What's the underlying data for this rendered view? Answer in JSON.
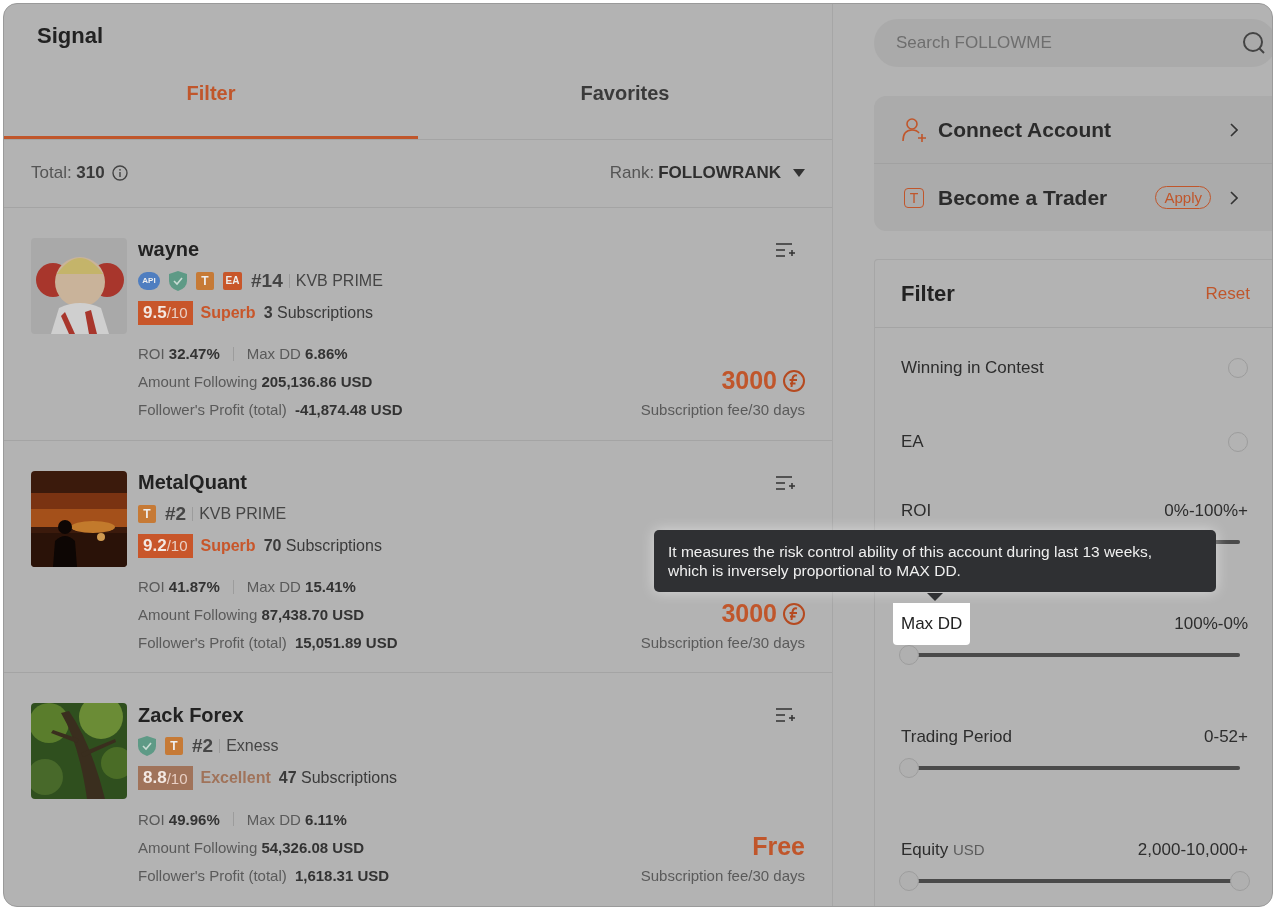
{
  "header": {
    "title": "Signal"
  },
  "tabs": [
    {
      "label": "Filter",
      "selected": true
    },
    {
      "label": "Favorites",
      "selected": false
    }
  ],
  "summary": {
    "total_label": "Total:",
    "total": "310",
    "rank_label": "Rank:",
    "rank": "FOLLOWRANK"
  },
  "signals": [
    {
      "name": "wayne",
      "picture": {
        "kind": "picture"
      },
      "badges": [
        {
          "kind": "api",
          "text": "API"
        },
        {
          "kind": "shield"
        },
        {
          "kind": "trader",
          "text": "T"
        },
        {
          "kind": "ea",
          "text": "EA"
        }
      ],
      "rank": "#14",
      "broker": "KVB PRIME",
      "score": {
        "value": "9.5",
        "max": "/10",
        "color": "#c8562a"
      },
      "grade": "Superb",
      "subscriptions": "3",
      "subscriptions_label": "Subscriptions",
      "roi_label": "ROI",
      "roi": "32.47%",
      "dd_label": "Max DD",
      "dd": "6.86%",
      "amount_label": "Amount Following",
      "amount": "205,136.86 USD",
      "profit_label": "Follower's Profit (total)",
      "profit": "-41,874.48 USD",
      "price": "3000",
      "coin": true,
      "fee_label": "Subscription fee/30 days"
    },
    {
      "name": "MetalQuant",
      "picture": {
        "kind": "picture"
      },
      "badges": [
        {
          "kind": "trader",
          "text": "T"
        }
      ],
      "rank": "#2",
      "broker": "KVB PRIME",
      "score": {
        "value": "9.2",
        "max": "/10",
        "color": "#c8562a"
      },
      "grade": "Superb",
      "subscriptions": "70",
      "subscriptions_label": "Subscriptions",
      "roi_label": "ROI",
      "roi": "41.87%",
      "dd_label": "Max DD",
      "dd": "15.41%",
      "amount_label": "Amount Following",
      "amount": "87,438.70 USD",
      "profit_label": "Follower's Profit (total)",
      "profit": "15,051.89 USD",
      "price": "3000",
      "coin": true,
      "fee_label": "Subscription fee/30 days"
    },
    {
      "name": "Zack Forex",
      "picture": {
        "kind": "picture"
      },
      "badges": [
        {
          "kind": "shield"
        },
        {
          "kind": "trader",
          "text": "T"
        }
      ],
      "rank": "#2",
      "broker": "Exness",
      "score": {
        "value": "8.8",
        "max": "/10",
        "color": "#a0735a"
      },
      "grade": "Excellent",
      "subscriptions": "47",
      "subscriptions_label": "Subscriptions",
      "roi_label": "ROI",
      "roi": "49.96%",
      "dd_label": "Max DD",
      "dd": "6.11%",
      "amount_label": "Amount Following",
      "amount": "54,326.08 USD",
      "profit_label": "Follower's Profit (total)",
      "profit": "1,618.31 USD",
      "price": "Free",
      "coin": false,
      "fee_label": "Subscription fee/30 days"
    }
  ],
  "search": {
    "placeholder": "Search FOLLOWME"
  },
  "menu": [
    {
      "kind": "connect",
      "label": "Connect Account"
    },
    {
      "kind": "trader",
      "label": "Become a Trader",
      "icon_text": "T",
      "tag": "Apply"
    }
  ],
  "filter": {
    "title": "Filter",
    "reset": "Reset",
    "options": [
      {
        "kind": "toggle",
        "label": "Winning in Contest",
        "checked": false
      },
      {
        "kind": "toggle",
        "label": "EA",
        "checked": false
      },
      {
        "kind": "range",
        "label": "ROI",
        "range": "0%-100%+",
        "level": 1,
        "end_handle": false,
        "highlighted": false
      },
      {
        "kind": "range",
        "label": "Max DD",
        "range": "100%-0%",
        "level": 1,
        "end_handle": false,
        "highlighted": true
      },
      {
        "kind": "range",
        "label": "Trading Period",
        "range": "0-52+",
        "level": 1,
        "end_handle": false,
        "highlighted": false
      },
      {
        "kind": "range",
        "label": "Equity",
        "unit": "USD",
        "range": "2,000-10,000+",
        "level": 1,
        "end_handle": true,
        "highlighted": false
      }
    ]
  },
  "tooltip": {
    "text": "It measures the risk control ability of this account during last 13 weeks, which is inversely proportional to MAX DD."
  }
}
